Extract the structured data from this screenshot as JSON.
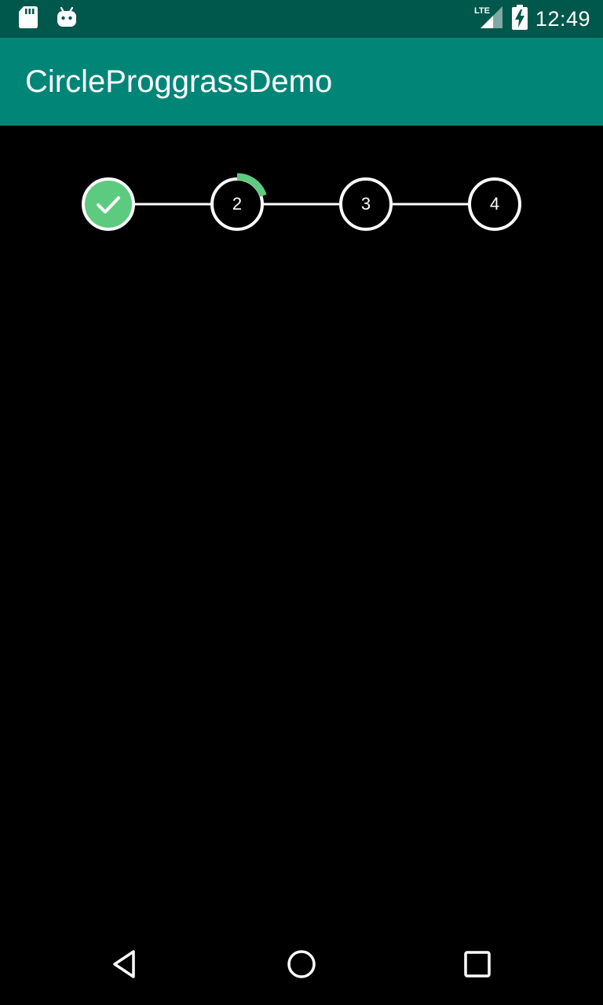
{
  "status_bar": {
    "time": "12:49",
    "network": "LTE",
    "left_icons": [
      "sd-card-icon",
      "android-icon"
    ],
    "right_icons": [
      "lte-signal-icon",
      "battery-charging-icon"
    ]
  },
  "app_bar": {
    "title": "CircleProggrassDemo",
    "color": "#008577"
  },
  "stepper": {
    "accent_color": "#5DCB7F",
    "steps": [
      {
        "label": "",
        "state": "completed",
        "icon": "check-icon"
      },
      {
        "label": "2",
        "state": "in-progress",
        "progress": 0.2
      },
      {
        "label": "3",
        "state": "pending"
      },
      {
        "label": "4",
        "state": "pending"
      }
    ]
  },
  "nav_bar": {
    "buttons": [
      "back-icon",
      "home-icon",
      "recents-icon"
    ]
  }
}
